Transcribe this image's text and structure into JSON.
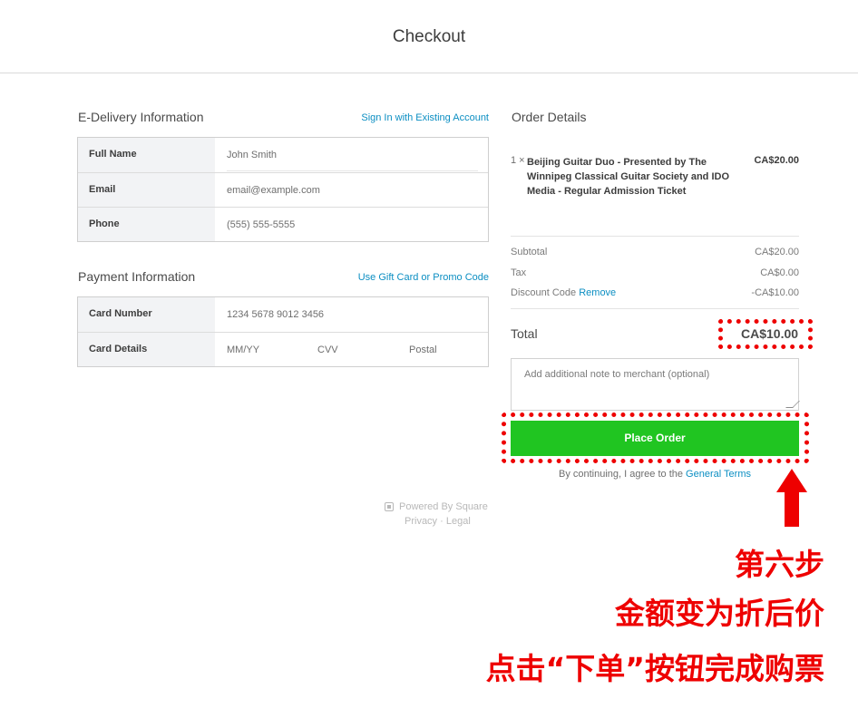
{
  "header": {
    "title": "Checkout"
  },
  "delivery": {
    "title": "E-Delivery Information",
    "signin_link": "Sign In with Existing Account",
    "fields": [
      {
        "label": "Full Name",
        "value": "John Smith"
      },
      {
        "label": "Email",
        "placeholder": "email@example.com"
      },
      {
        "label": "Phone",
        "placeholder": "(555) 555-5555"
      }
    ]
  },
  "payment": {
    "title": "Payment Information",
    "gift_link": "Use Gift Card or Promo Code",
    "card_number_label": "Card Number",
    "card_number_placeholder": "1234 5678 9012 3456",
    "card_details_label": "Card Details",
    "expiry_placeholder": "MM/YY",
    "cvv_placeholder": "CVV",
    "postal_placeholder": "Postal"
  },
  "order": {
    "title": "Order Details",
    "item": {
      "qty": "1 ×",
      "name": "Beijing Guitar Duo - Presented by The Winnipeg Classical Guitar Society and IDO Media - Regular Admission Ticket",
      "price": "CA$20.00"
    },
    "subtotal_label": "Subtotal",
    "subtotal_value": "CA$20.00",
    "tax_label": "Tax",
    "tax_value": "CA$0.00",
    "discount_label": "Discount Code",
    "discount_remove": "Remove",
    "discount_value": "-CA$10.00",
    "total_label": "Total",
    "total_value": "CA$10.00",
    "note_placeholder": "Add additional note to merchant (optional)",
    "place_order": "Place Order",
    "terms_prefix": "By continuing, I agree to the",
    "terms_link": "General Terms"
  },
  "footer": {
    "powered": "Powered By Square",
    "privacy": "Privacy",
    "separator": "·",
    "legal": "Legal"
  },
  "annotation": {
    "line1": "第六步",
    "line2": "金额变为折后价",
    "line3": "点击“下单”按钮完成购票",
    "color": "#ee0000"
  },
  "colors": {
    "accent_link": "#0b8ec2",
    "place_order_bg": "#20c521"
  }
}
